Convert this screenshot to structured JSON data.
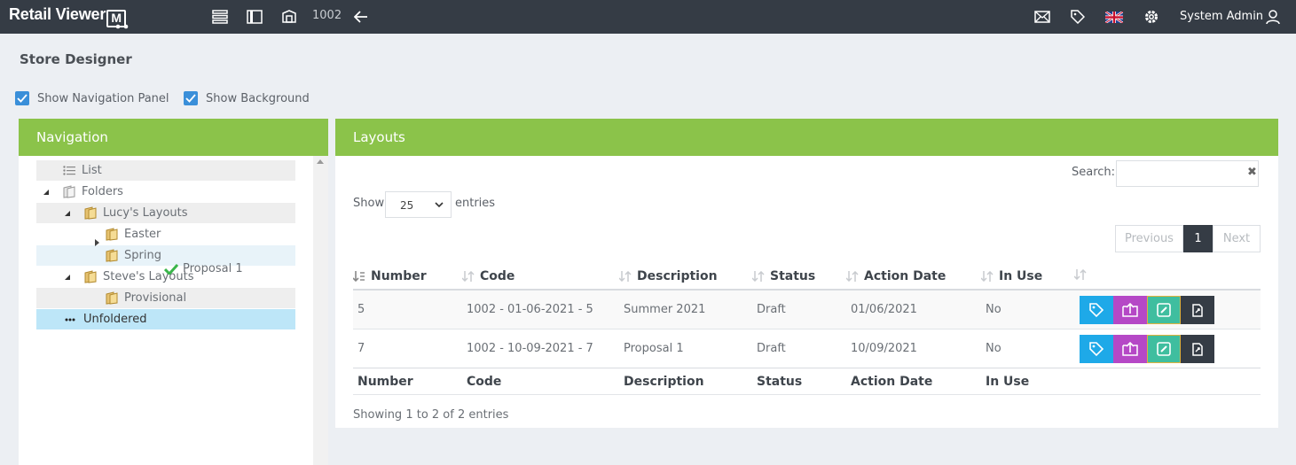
{
  "app": {
    "logo_text": "Retail Viewer",
    "logo_mark": "M"
  },
  "topbar": {
    "store_number": "1002",
    "user_name": "System Admin"
  },
  "page": {
    "title": "Store Designer",
    "show_navigation_panel": "Show Navigation Panel",
    "show_background": "Show Background"
  },
  "navigation": {
    "title": "Navigation",
    "tree": {
      "list": "List",
      "folders": "Folders",
      "lucys_layouts": "Lucy's Layouts",
      "easter": "Easter",
      "spring": "Spring",
      "steves_layouts": "Steve's Layouts",
      "provisional": "Provisional",
      "unfoldered": "Unfoldered"
    },
    "drag_item": "Proposal 1"
  },
  "layouts": {
    "title": "Layouts",
    "search_label": "Search:",
    "search_value": "",
    "show_label": "Show",
    "entries_value": "25",
    "entries_label": "entries",
    "pager": {
      "previous": "Previous",
      "current": "1",
      "next": "Next"
    },
    "columns": {
      "number": "Number",
      "code": "Code",
      "description": "Description",
      "status": "Status",
      "action_date": "Action Date",
      "in_use": "In Use"
    },
    "rows": [
      {
        "number": "5",
        "code": "1002 - 01-06-2021 - 5",
        "description": "Summer 2021",
        "status": "Draft",
        "action_date": "01/06/2021",
        "in_use": "No"
      },
      {
        "number": "7",
        "code": "1002 - 10-09-2021 - 7",
        "description": "Proposal 1",
        "status": "Draft",
        "action_date": "10/09/2021",
        "in_use": "No"
      }
    ],
    "showing": "Showing 1 to 2 of 2 entries"
  },
  "colors": {
    "topbar": "#353c45",
    "panel_header": "#8bc34a",
    "checkbox": "#3a8fd9",
    "btn_tag": "#1ea9e8",
    "btn_publish": "#b548c6",
    "btn_edit": "#3fbe9f",
    "btn_copy": "#353c45",
    "tree_selected": "#bde6f8"
  }
}
